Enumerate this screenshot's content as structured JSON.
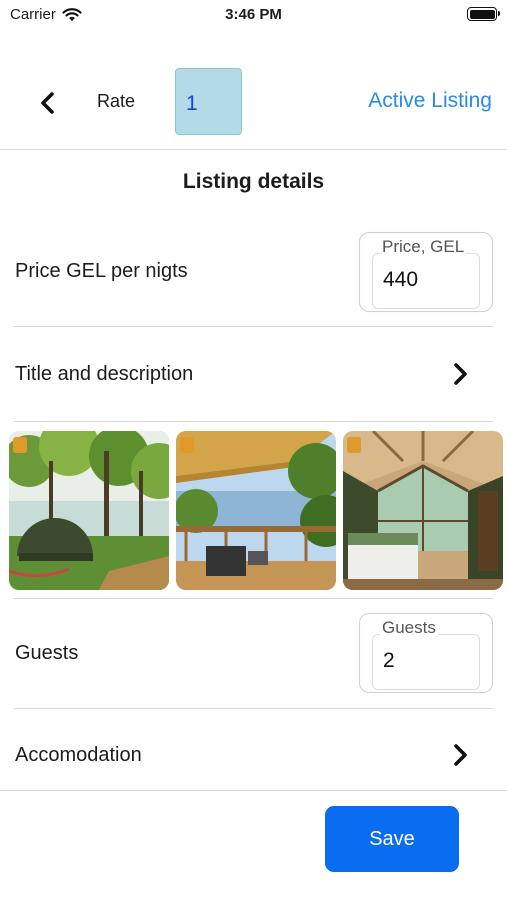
{
  "status_bar": {
    "carrier": "Carrier",
    "time": "3:46 PM"
  },
  "nav": {
    "rate_label": "Rate",
    "rate_value": "1",
    "active_link": "Active Listing"
  },
  "section_title": "Listing details",
  "price_row": {
    "label": "Price GEL per nigts",
    "field_caption": "Price, GEL",
    "field_value": "440"
  },
  "title_row": {
    "label": "Title and description"
  },
  "photos": [
    {
      "name": "dome-tent-forest"
    },
    {
      "name": "deck-sea-view"
    },
    {
      "name": "dome-bedroom-interior"
    }
  ],
  "guests_row": {
    "label": "Guests",
    "field_caption": "Guests",
    "field_value": "2"
  },
  "accommodation_row": {
    "label": "Accomodation"
  },
  "save_button": {
    "label": "Save"
  },
  "colors": {
    "accent": "#0a6cf0",
    "link": "#2b8ae6",
    "rate_field_bg": "#b3dbe7"
  }
}
